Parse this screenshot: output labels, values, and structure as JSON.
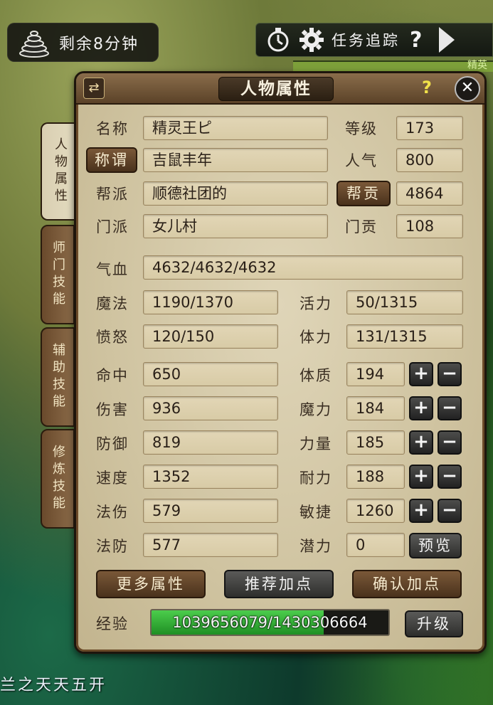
{
  "hud": {
    "timer_text": "剩余8分钟",
    "quest_label": "任务追踪",
    "quest_help": "?",
    "strip_text": "精英",
    "ground_text": "兰之天天五开"
  },
  "panel": {
    "title": "人物属性",
    "swap_glyph": "⇄",
    "help_glyph": "?",
    "close_glyph": "✕",
    "tabs": [
      "人物属性",
      "师门技能",
      "辅助技能",
      "修炼技能"
    ],
    "top": {
      "name_label": "名称",
      "name_value": "精灵王ピ",
      "level_label": "等级",
      "level_value": "173",
      "title_button": "称谓",
      "title_value": "吉鼠丰年",
      "popularity_label": "人气",
      "popularity_value": "800",
      "guild_label": "帮派",
      "guild_value": "顺德社团的",
      "guild_contrib_button": "帮贡",
      "guild_contrib_value": "4864",
      "school_label": "门派",
      "school_value": "女儿村",
      "school_contrib_label": "门贡",
      "school_contrib_value": "108"
    },
    "vitals": {
      "hp_label": "气血",
      "hp_value": "4632/4632/4632",
      "mp_label": "魔法",
      "mp_value": "1190/1370",
      "vigor_label": "活力",
      "vigor_value": "50/1315",
      "rage_label": "愤怒",
      "rage_value": "120/150",
      "stamina_label": "体力",
      "stamina_value": "131/1315"
    },
    "combat": [
      {
        "label": "命中",
        "value": "650"
      },
      {
        "label": "伤害",
        "value": "936"
      },
      {
        "label": "防御",
        "value": "819"
      },
      {
        "label": "速度",
        "value": "1352"
      },
      {
        "label": "法伤",
        "value": "579"
      },
      {
        "label": "法防",
        "value": "577"
      }
    ],
    "attributes": [
      {
        "label": "体质",
        "value": "194"
      },
      {
        "label": "魔力",
        "value": "184"
      },
      {
        "label": "力量",
        "value": "185"
      },
      {
        "label": "耐力",
        "value": "188"
      },
      {
        "label": "敏捷",
        "value": "1260"
      }
    ],
    "potential_label": "潜力",
    "potential_value": "0",
    "preview_button": "预览",
    "plus_glyph": "+",
    "minus_glyph": "−",
    "buttons": {
      "more_attributes": "更多属性",
      "recommend_points": "推荐加点",
      "confirm_points": "确认加点"
    },
    "experience": {
      "label": "经验",
      "value": "1039656079/1430306664",
      "fraction": 0.727,
      "upgrade_button": "升级"
    }
  }
}
